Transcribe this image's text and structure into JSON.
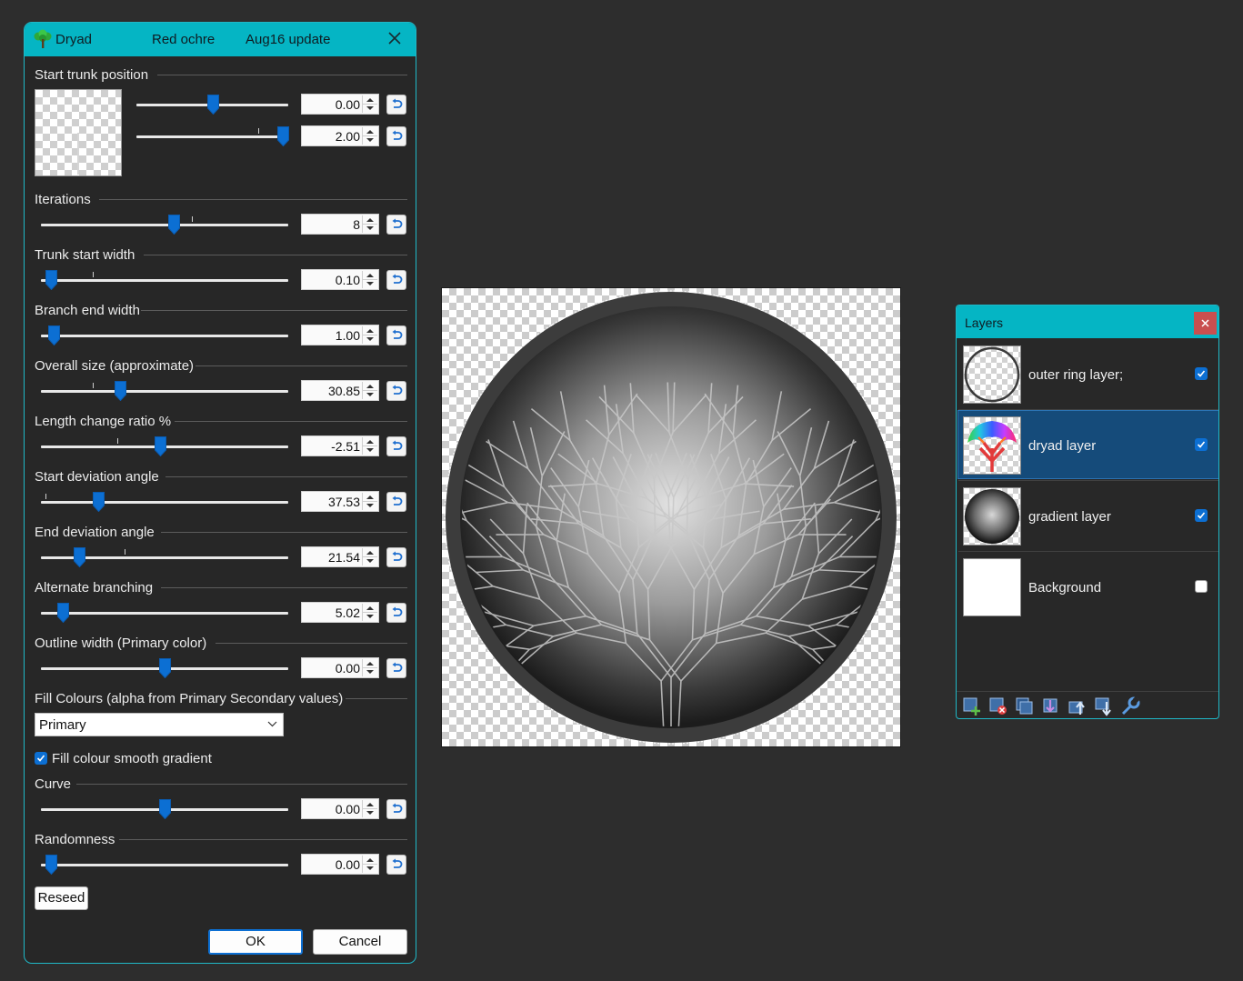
{
  "dialog": {
    "app_title": "Dryad",
    "preset_name": "Red ochre",
    "version_label": "Aug16 update",
    "start_trunk": {
      "label": "Start trunk position",
      "x_value": "0.00",
      "x_level": 0.5,
      "y_value": "2.00",
      "y_level": 1.0
    },
    "params": [
      {
        "label": "Iterations",
        "value": "8",
        "level": 0.54
      },
      {
        "label": "Trunk start width",
        "value": "0.10",
        "level": 0.02
      },
      {
        "label": "Branch end width",
        "value": "1.00",
        "level": 0.03
      },
      {
        "label": "Overall size (approximate)",
        "value": "30.85",
        "level": 0.31
      },
      {
        "label": "Length change ratio %",
        "value": "-2.51",
        "level": 0.48
      },
      {
        "label": "Start deviation angle",
        "value": "37.53",
        "level": 0.22
      },
      {
        "label": "End deviation angle",
        "value": "21.54",
        "level": 0.14
      },
      {
        "label": "Alternate branching",
        "value": "5.02",
        "level": 0.07
      },
      {
        "label": "Outline width (Primary color)",
        "value": "0.00",
        "level": 0.5
      }
    ],
    "fill": {
      "label": "Fill Colours (alpha from Primary  Secondary values)",
      "selected": "Primary",
      "smooth_label": "Fill colour smooth gradient",
      "smooth_checked": true
    },
    "curve": {
      "label": "Curve",
      "value": "0.00",
      "level": 0.5
    },
    "randomness": {
      "label": "Randomness",
      "value": "0.00",
      "level": 0.02
    },
    "reseed_label": "Reseed",
    "ok_label": "OK",
    "cancel_label": "Cancel"
  },
  "layers": {
    "title": "Layers",
    "items": [
      {
        "name": "outer ring layer;",
        "visible": true,
        "selected": false,
        "icon": "ring-thumbnail"
      },
      {
        "name": "dryad layer",
        "visible": true,
        "selected": true,
        "icon": "rainbow-tree-thumbnail"
      },
      {
        "name": "gradient layer",
        "visible": true,
        "selected": false,
        "icon": "gradient-circle-thumbnail"
      },
      {
        "name": "Background",
        "visible": false,
        "selected": false,
        "icon": "white-thumbnail"
      }
    ],
    "toolbar_icons": [
      "add-layer-icon",
      "delete-layer-icon",
      "duplicate-layer-icon",
      "merge-down-icon",
      "move-up-icon",
      "move-down-icon",
      "properties-icon"
    ]
  },
  "colors": {
    "accent": "#05b5c4",
    "selection": "#154b7a",
    "slider_thumb": "#0c6fd3",
    "close_button": "#c94f4f"
  }
}
